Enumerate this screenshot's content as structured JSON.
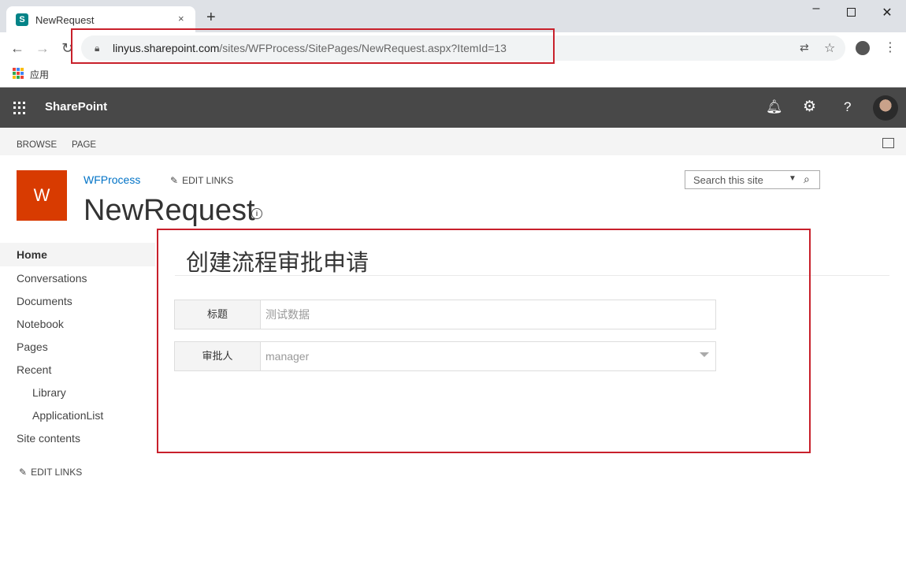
{
  "browser": {
    "tab_title": "NewRequest",
    "tab_close": "×",
    "new_tab": "+",
    "url_host": "linyus.sharepoint.com",
    "url_path": "/sites/WFProcess/SitePages/NewRequest.aspx?ItemId=13",
    "bookmarks_label": "应用",
    "colors": {
      "highlight": "#c8202b",
      "favicon": "#038387"
    }
  },
  "suitebar": {
    "brand": "SharePoint",
    "help": "?",
    "color": "#484848"
  },
  "ribbon": {
    "tabs": [
      "BROWSE",
      "PAGE"
    ]
  },
  "site": {
    "logo_letter": "W",
    "logo_color": "#d83b01",
    "name": "WFProcess",
    "edit_links": "EDIT LINKS",
    "page_title": "NewRequest",
    "search_placeholder": "Search this site"
  },
  "leftnav": {
    "items": [
      {
        "label": "Home"
      },
      {
        "label": "Conversations"
      },
      {
        "label": "Documents"
      },
      {
        "label": "Notebook"
      },
      {
        "label": "Pages"
      },
      {
        "label": "Recent"
      },
      {
        "label": "Library"
      },
      {
        "label": "ApplicationList"
      },
      {
        "label": "Site contents"
      }
    ],
    "edit_links": "EDIT LINKS"
  },
  "form": {
    "title": "创建流程审批申请",
    "fields": [
      {
        "label": "标题",
        "value": "测试数据"
      },
      {
        "label": "审批人",
        "value": "manager"
      }
    ]
  }
}
